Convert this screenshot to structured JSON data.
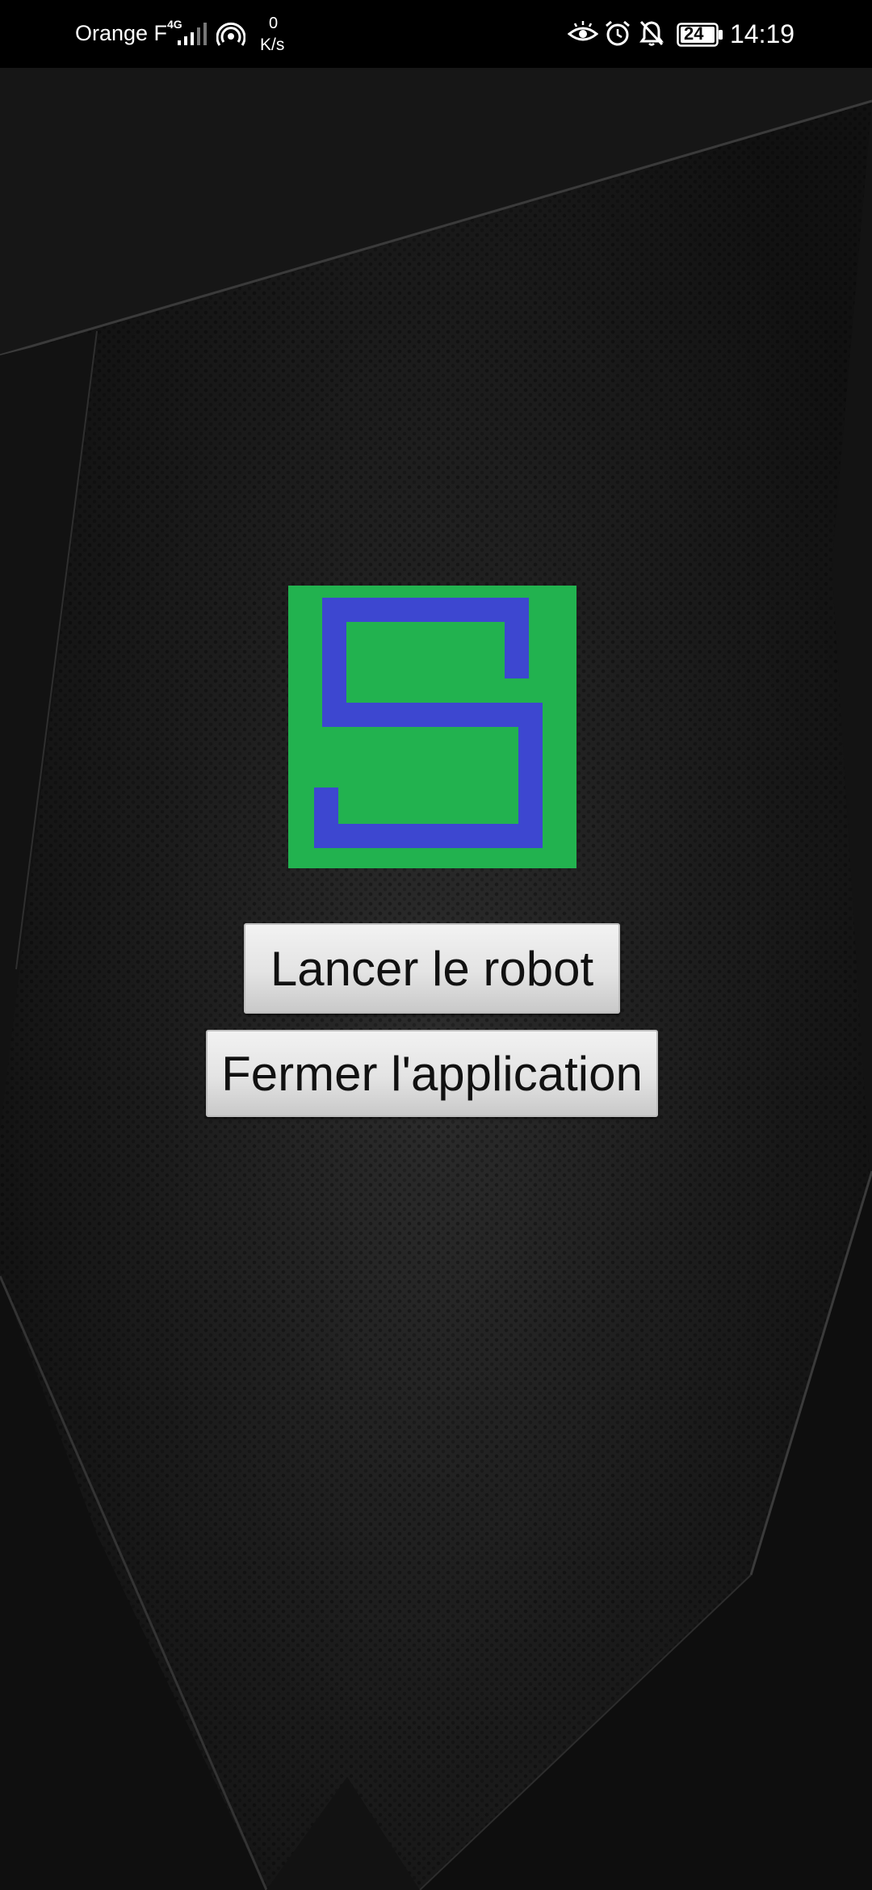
{
  "status_bar": {
    "carrier": "Orange F",
    "network_type": "4G",
    "speed_value": "0",
    "speed_unit": "K/s",
    "battery_level": "24",
    "time": "14:19",
    "icons": [
      "signal-icon",
      "hotspot-icon",
      "eye-comfort-icon",
      "alarm-icon",
      "notifications-off-icon",
      "battery-icon"
    ]
  },
  "logo": {
    "letter": "S",
    "background_color": "#22b24f",
    "letter_color": "#3d47d0"
  },
  "buttons": {
    "launch_label": "Lancer le robot",
    "close_label": "Fermer l'application"
  }
}
